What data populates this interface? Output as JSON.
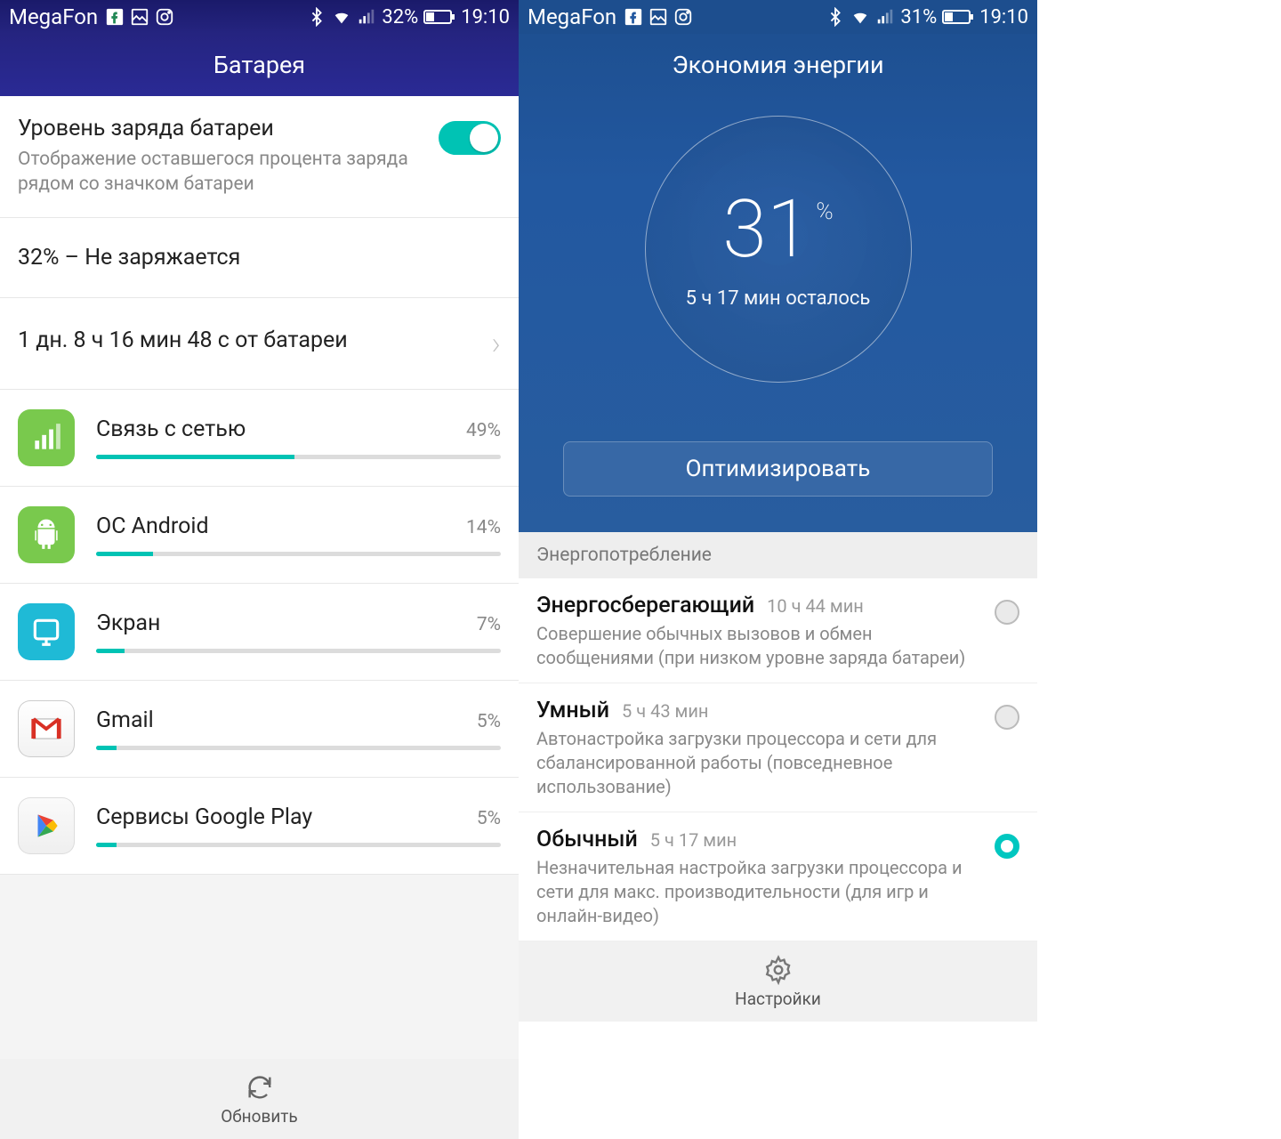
{
  "left": {
    "status": {
      "carrier": "MegaFon",
      "battery": "32%",
      "time": "19:10"
    },
    "title": "Батарея",
    "toggle": {
      "title": "Уровень заряда батареи",
      "sub": "Отображение оставшегося процента заряда рядом со значком батареи"
    },
    "state": "32% – Не заряжается",
    "since": "1 дн. 8 ч 16 мин 48 с от батареи",
    "items": [
      {
        "name": "Связь с сетью",
        "pct": "49%",
        "w": 49,
        "icon": "signal",
        "bg": "bg-green"
      },
      {
        "name": "ОС Android",
        "pct": "14%",
        "w": 14,
        "icon": "android",
        "bg": "bg-android"
      },
      {
        "name": "Экран",
        "pct": "7%",
        "w": 7,
        "icon": "screen",
        "bg": "bg-teal"
      },
      {
        "name": "Gmail",
        "pct": "5%",
        "w": 5,
        "icon": "gmail",
        "bg": "bg-gmail"
      },
      {
        "name": "Сервисы Google Play",
        "pct": "5%",
        "w": 5,
        "icon": "play",
        "bg": "bg-play"
      }
    ],
    "footer": "Обновить"
  },
  "right": {
    "status": {
      "carrier": "MegaFon",
      "battery": "31%",
      "time": "19:10"
    },
    "title": "Экономия энергии",
    "pct": "31",
    "pctSym": "%",
    "remaining": "5 ч 17 мин осталось",
    "optimize": "Оптимизировать",
    "section": "Энергопотребление",
    "modes": [
      {
        "name": "Энергосберегающий",
        "time": "10 ч 44 мин",
        "desc": "Совершение обычных вызовов и обмен сообщениями (при низком уровне заряда батареи)",
        "sel": false
      },
      {
        "name": "Умный",
        "time": "5 ч 43 мин",
        "desc": "Автонастройка загрузки процессора и сети для сбалансированной работы (повседневное использование)",
        "sel": false
      },
      {
        "name": "Обычный",
        "time": "5 ч 17 мин",
        "desc": "Незначительная настройка загрузки процессора и сети для макс. производительности (для игр и онлайн-видео)",
        "sel": true
      }
    ],
    "footer": "Настройки"
  }
}
